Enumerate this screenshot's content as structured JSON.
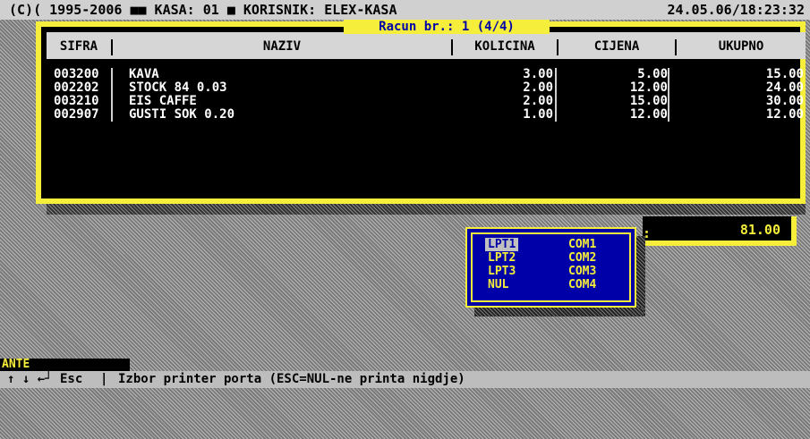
{
  "titlebar": {
    "left": "(C)( 1995-2006 ■■ KASA: 01 ■ KORISNIK: ELEX-KASA",
    "datetime": "24.05.06/18:23:32"
  },
  "receipt": {
    "title": "Racun br.: 1 (4/4)",
    "columns": [
      "SIFRA",
      "NAZIV",
      "KOLICINA",
      "CIJENA",
      "UKUPNO"
    ],
    "rows": [
      {
        "sifra": "003200",
        "naziv": "KAVA",
        "kolicina": "3.00",
        "cijena": "5.00",
        "ukupno": "15.00"
      },
      {
        "sifra": "002202",
        "naziv": "STOCK 84 0.03",
        "kolicina": "2.00",
        "cijena": "12.00",
        "ukupno": "24.00"
      },
      {
        "sifra": "003210",
        "naziv": "EIS CAFFE",
        "kolicina": "2.00",
        "cijena": "15.00",
        "ukupno": "30.00"
      },
      {
        "sifra": "002907",
        "naziv": "GUSTI SOK 0.20",
        "kolicina": "1.00",
        "cijena": "12.00",
        "ukupno": "12.00"
      }
    ]
  },
  "total": {
    "label": ":",
    "value": "81.00"
  },
  "printer_menu": {
    "options": [
      {
        "label": "LPT1",
        "selected": true
      },
      {
        "label": "LPT2",
        "selected": false
      },
      {
        "label": "LPT3",
        "selected": false
      },
      {
        "label": "NUL",
        "selected": false
      },
      {
        "label": "COM1",
        "selected": false
      },
      {
        "label": "COM2",
        "selected": false
      },
      {
        "label": "COM3",
        "selected": false
      },
      {
        "label": "COM4",
        "selected": false
      }
    ]
  },
  "user": "ANTE",
  "statusbar": {
    "keys": "↑ ↓ ←┘ Esc",
    "separator": "|",
    "message": "Izbor printer porta (ESC=NUL-ne printa nigdje)"
  },
  "colors": {
    "accent": "#f5ee3a",
    "popup_bg": "#0000a8"
  }
}
